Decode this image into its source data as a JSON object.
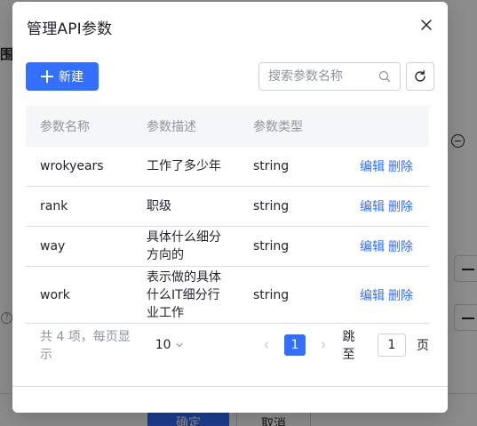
{
  "background": {
    "left_fragment": "围",
    "help_glyph": "?",
    "confirm_label": "确定",
    "cancel_label": "取消"
  },
  "modal": {
    "title": "管理API参数",
    "new_button_label": "新建",
    "search_placeholder": "搜索参数名称"
  },
  "table": {
    "headers": [
      "参数名称",
      "参数描述",
      "参数类型",
      ""
    ],
    "rows": [
      {
        "name": "wrokyears",
        "desc_lines": [
          "工作了多少年"
        ],
        "type": "string"
      },
      {
        "name": "rank",
        "desc_lines": [
          "职级"
        ],
        "type": "string"
      },
      {
        "name": "way",
        "desc_lines": [
          "具体什么细分",
          "方向的"
        ],
        "type": "string"
      },
      {
        "name": "work",
        "desc_lines": [
          "表示做的具体",
          "什么IT细分行",
          "业工作"
        ],
        "type": "string"
      }
    ],
    "edit_label": "编辑",
    "delete_label": "删除"
  },
  "pagination": {
    "total_text": "共 4 项，每页显示",
    "page_size": "10",
    "current_page": "1",
    "jump_label": "跳至",
    "jump_value": "1",
    "page_unit": "页"
  },
  "colors": {
    "primary": "#3370ff",
    "text": "#1f2329",
    "muted": "#8f959e"
  }
}
